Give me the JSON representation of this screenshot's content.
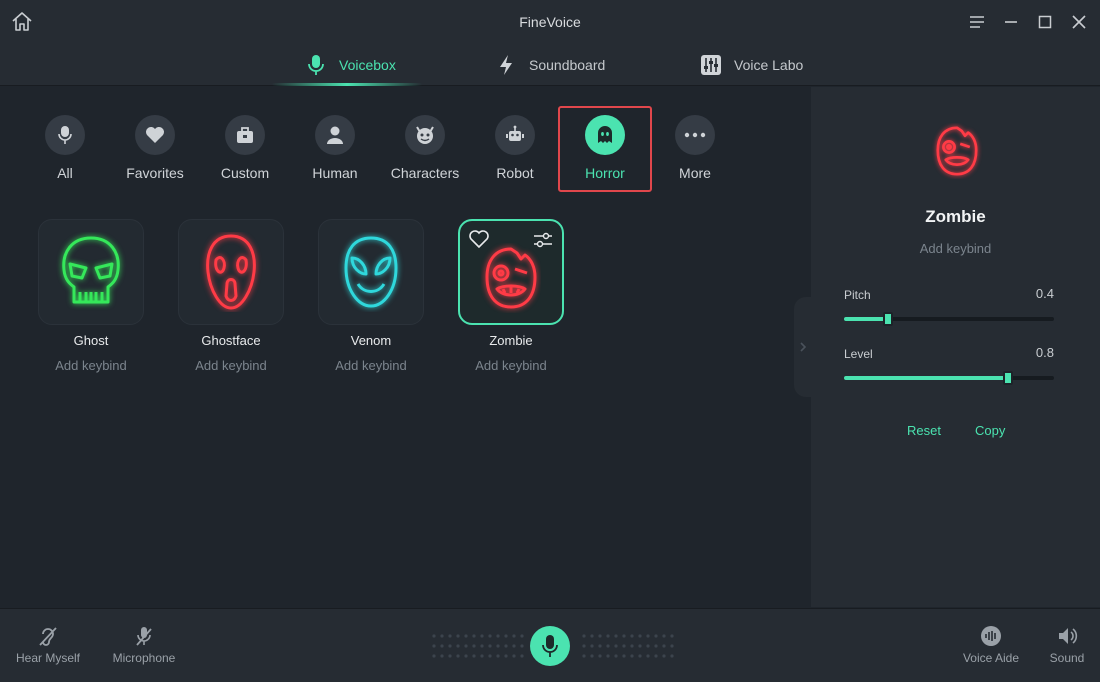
{
  "app": {
    "title": "FineVoice"
  },
  "nav": {
    "tabs": [
      {
        "label": "Voicebox",
        "icon": "microphone-icon",
        "active": true
      },
      {
        "label": "Soundboard",
        "icon": "lightning-icon",
        "active": false
      },
      {
        "label": "Voice Labo",
        "icon": "equalizer-icon",
        "active": false
      }
    ]
  },
  "categories": [
    {
      "label": "All",
      "icon": "microphone-icon"
    },
    {
      "label": "Favorites",
      "icon": "heart-icon"
    },
    {
      "label": "Custom",
      "icon": "briefcase-icon"
    },
    {
      "label": "Human",
      "icon": "person-icon"
    },
    {
      "label": "Characters",
      "icon": "devil-icon"
    },
    {
      "label": "Robot",
      "icon": "robot-icon"
    },
    {
      "label": "Horror",
      "icon": "ghost-icon",
      "active": true
    },
    {
      "label": "More",
      "icon": "ellipsis-icon"
    }
  ],
  "voices": [
    {
      "name": "Ghost",
      "keybind": "Add keybind",
      "color": "#35e85a"
    },
    {
      "name": "Ghostface",
      "keybind": "Add keybind",
      "color": "#ff3b46"
    },
    {
      "name": "Venom",
      "keybind": "Add keybind",
      "color": "#2fd8dc"
    },
    {
      "name": "Zombie",
      "keybind": "Add keybind",
      "color": "#ff3b46",
      "selected": true
    }
  ],
  "side": {
    "name": "Zombie",
    "keybind": "Add keybind",
    "pitch": {
      "label": "Pitch",
      "value": "0.4",
      "fraction": 0.21
    },
    "level": {
      "label": "Level",
      "value": "0.8",
      "fraction": 0.78
    },
    "reset_label": "Reset",
    "copy_label": "Copy"
  },
  "bottom": {
    "hear_myself": "Hear Myself",
    "microphone": "Microphone",
    "voice_aide": "Voice Aide",
    "sound": "Sound"
  },
  "colors": {
    "accent": "#4be3b0",
    "highlight": "#e0474c"
  }
}
